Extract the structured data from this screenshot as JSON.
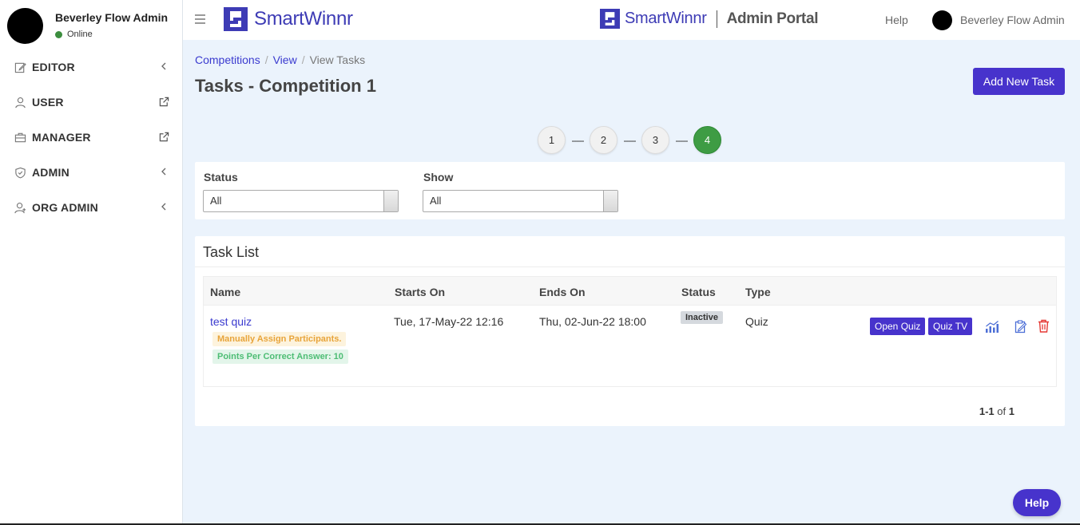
{
  "sidebar": {
    "user_name": "Beverley Flow Admin",
    "status": "Online",
    "items": [
      {
        "label": "EDITOR",
        "icon": "edit-icon",
        "trail": "chevron-left-icon"
      },
      {
        "label": "USER",
        "icon": "user-icon",
        "trail": "external-link-icon"
      },
      {
        "label": "MANAGER",
        "icon": "briefcase-icon",
        "trail": "external-link-icon"
      },
      {
        "label": "ADMIN",
        "icon": "shield-icon",
        "trail": "chevron-left-icon"
      },
      {
        "label": "ORG ADMIN",
        "icon": "user-group-icon",
        "trail": "chevron-left-icon"
      }
    ]
  },
  "header": {
    "brand": "SmartWinnr",
    "portal_brand": "SmartWinnr",
    "portal_label": "Admin Portal",
    "help": "Help",
    "user_name": "Beverley Flow Admin"
  },
  "breadcrumb": {
    "items": [
      "Competitions",
      "View"
    ],
    "current": "View Tasks"
  },
  "page": {
    "title": "Tasks - Competition 1",
    "add_button": "Add New Task"
  },
  "stepper": {
    "steps": [
      "1",
      "2",
      "3",
      "4"
    ],
    "dash": "-----",
    "active_step": "4"
  },
  "filters": {
    "status_label": "Status",
    "status_value": "All",
    "show_label": "Show",
    "show_value": "All"
  },
  "task_list": {
    "title": "Task List",
    "columns": [
      "Name",
      "Starts On",
      "Ends On",
      "Status",
      "Type"
    ],
    "rows": [
      {
        "name": "test quiz",
        "tag1": "Manually Assign Participants.",
        "tag2": "Points Per Correct Answer: 10",
        "starts_on": "Tue, 17-May-22 12:16",
        "ends_on": "Thu, 02-Jun-22 18:00",
        "status": "Inactive",
        "type": "Quiz",
        "open_quiz": "Open Quiz",
        "quiz_tv": "Quiz TV"
      }
    ],
    "pager": {
      "range": "1-1",
      "of": "of",
      "total": "1"
    }
  },
  "help_fab": "Help",
  "colors": {
    "accent": "#4733cc",
    "link": "#3a3acf",
    "active_step": "#3e9c44",
    "danger": "#e53935"
  }
}
